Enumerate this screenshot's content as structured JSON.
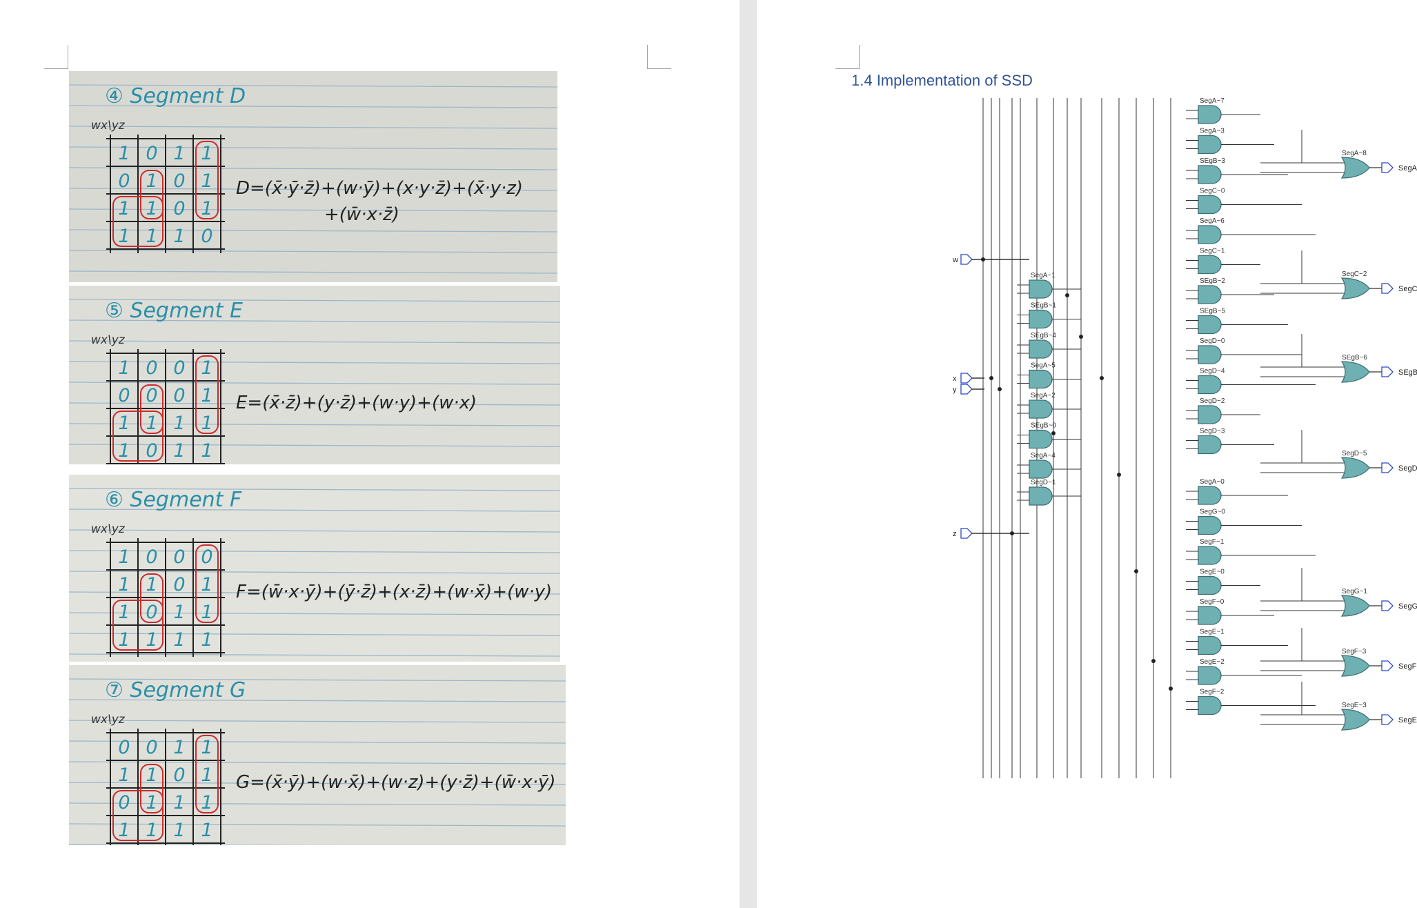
{
  "left_page": {
    "photos": [
      {
        "title": "④ Segment D",
        "axis": "wx\\yz",
        "kmap": [
          [
            "1",
            "0",
            "1",
            "1"
          ],
          [
            "0",
            "1",
            "0",
            "1"
          ],
          [
            "1",
            "1",
            "0",
            "1"
          ],
          [
            "1",
            "1",
            "1",
            "0"
          ]
        ],
        "equation": "D=(x̄·ȳ·z̄)+(w·ȳ)+(x·y·z̄)+(x̄·y·z)",
        "equation_line2": "+(w̄·x·z̄)"
      },
      {
        "title": "⑤ Segment E",
        "axis": "wx\\yz",
        "kmap": [
          [
            "1",
            "0",
            "0",
            "1"
          ],
          [
            "0",
            "0",
            "0",
            "1"
          ],
          [
            "1",
            "1",
            "1",
            "1"
          ],
          [
            "1",
            "0",
            "1",
            "1"
          ]
        ],
        "equation": "E=(x̄·z̄)+(y·z̄)+(w·y)+(w·x)",
        "equation_line2": ""
      },
      {
        "title": "⑥ Segment F",
        "axis": "wx\\yz",
        "kmap": [
          [
            "1",
            "0",
            "0",
            "0"
          ],
          [
            "1",
            "1",
            "0",
            "1"
          ],
          [
            "1",
            "0",
            "1",
            "1"
          ],
          [
            "1",
            "1",
            "1",
            "1"
          ]
        ],
        "equation": "F=(w̄·x·ȳ)+(ȳ·z̄)+(x·z̄)+(w·x̄)+(w·y)",
        "equation_line2": ""
      },
      {
        "title": "⑦ Segment G",
        "axis": "wx\\yz",
        "kmap": [
          [
            "0",
            "0",
            "1",
            "1"
          ],
          [
            "1",
            "1",
            "0",
            "1"
          ],
          [
            "0",
            "1",
            "1",
            "1"
          ],
          [
            "1",
            "1",
            "1",
            "1"
          ]
        ],
        "equation": "G=(x̄·ȳ)+(w·x̄)+(w·z)+(y·z̄)+(w̄·x·ȳ)",
        "equation_line2": ""
      }
    ]
  },
  "right_page": {
    "heading": "1.4 Implementation of SSD",
    "circuit": {
      "inputs": [
        "w",
        "x",
        "y",
        "z"
      ],
      "and_col1": [
        "SegA~1",
        "SEgB~1",
        "SEgB~4",
        "SegA~5",
        "SegA~2",
        "SEgB~0",
        "SegA~4",
        "SegD~1"
      ],
      "and_col2": [
        "SegA~7",
        "SegA~3",
        "SEgB~3",
        "SegC~0",
        "SegA~6",
        "SegC~1",
        "SEgB~2",
        "SEgB~5",
        "SegD~0",
        "SegD~4",
        "SegD~2",
        "SegD~3",
        "SegA~0",
        "SegG~0",
        "SegF~1",
        "SegE~0",
        "SegF~0",
        "SegE~1",
        "SegE~2",
        "SegF~2"
      ],
      "or_gates": [
        "SegA~8",
        "SegC~2",
        "SEgB~6",
        "SegD~5",
        "SegG~1",
        "SegF~3",
        "SegE~3"
      ],
      "outputs": [
        "SegA",
        "SegC",
        "SEgB",
        "SegD",
        "SegG",
        "SegF",
        "SegE"
      ]
    }
  }
}
